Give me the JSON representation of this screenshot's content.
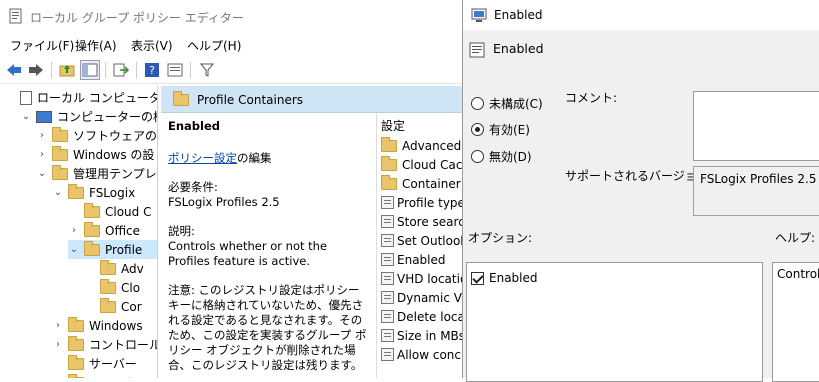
{
  "main": {
    "title": "ローカル グループ ポリシー エディター",
    "menu": [
      "ファイル(F)",
      "操作(A)",
      "表示(V)",
      "ヘルプ(H)"
    ],
    "tree": [
      {
        "label": "ローカル コンピューター ポ",
        "indent": 0,
        "chev": ""
      },
      {
        "label": "コンピューターの構成",
        "indent": 1,
        "chev": "⌄"
      },
      {
        "label": "ソフトウェアの設",
        "indent": 2,
        "chev": "›"
      },
      {
        "label": "Windows の設",
        "indent": 2,
        "chev": "›"
      },
      {
        "label": "管理用テンプレ",
        "indent": 2,
        "chev": "⌄"
      },
      {
        "label": "FSLogix",
        "indent": 3,
        "chev": "⌄"
      },
      {
        "label": "Cloud C",
        "indent": 4,
        "chev": ""
      },
      {
        "label": "Office",
        "indent": 4,
        "chev": "›"
      },
      {
        "label": "Profile",
        "indent": 4,
        "chev": "⌄"
      },
      {
        "label": "Adv",
        "indent": 5,
        "chev": ""
      },
      {
        "label": "Clo",
        "indent": 5,
        "chev": ""
      },
      {
        "label": "Cor",
        "indent": 5,
        "chev": ""
      },
      {
        "label": "Windows",
        "indent": 3,
        "chev": "›"
      },
      {
        "label": "コントロール",
        "indent": 3,
        "chev": "›"
      },
      {
        "label": "サーバー",
        "indent": 3,
        "chev": ""
      },
      {
        "label": "システム",
        "indent": 3,
        "chev": "›"
      }
    ],
    "header": "Profile Containers",
    "extended": {
      "heading": "Enabled",
      "edit_link": "ポリシー設定",
      "edit_suffix": "の編集",
      "req_label": "必要条件:",
      "req_value": "FSLogix Profiles 2.5",
      "desc_label": "説明:",
      "desc_value": "Controls whether or not the Profiles feature is active.",
      "note": "注意: このレジストリ設定はポリシー キーに格納されていないため、優先される設定であると見なされます。そのため、この設定を実装するグループ ポリシー オブジェクトが削除された場合、このレジストリ設定は残ります。"
    },
    "settings_header": "設定",
    "settings": [
      {
        "label": "Advanced",
        "type": "folder"
      },
      {
        "label": "Cloud Cache",
        "type": "folder"
      },
      {
        "label": "Container and",
        "type": "folder"
      },
      {
        "label": "Profile type",
        "type": "policy"
      },
      {
        "label": "Store search",
        "type": "policy"
      },
      {
        "label": "Set Outlook",
        "type": "policy"
      },
      {
        "label": "Enabled",
        "type": "policy"
      },
      {
        "label": "VHD location",
        "type": "policy"
      },
      {
        "label": "Dynamic VHD",
        "type": "policy"
      },
      {
        "label": "Delete local",
        "type": "policy"
      },
      {
        "label": "Size in MBs",
        "type": "policy"
      },
      {
        "label": "Allow concu",
        "type": "policy"
      }
    ]
  },
  "dialog": {
    "title": "Enabled",
    "heading": "Enabled",
    "radio_not_configured": "未構成(C)",
    "radio_enabled": "有効(E)",
    "radio_disabled": "無効(D)",
    "selected": "enabled",
    "comment_label": "コメント:",
    "supported_label": "サポートされるバージョン:",
    "supported_value": "FSLogix Profiles 2.5",
    "options_label": "オプション:",
    "help_label": "ヘルプ:",
    "option_checkbox": "Enabled",
    "help_text": "Controls"
  },
  "colors": {
    "selection": "#cce8ff",
    "header_bg": "#cfe5f5",
    "folder": "#e9c46a",
    "accent_blue": "#1a5fb4"
  }
}
